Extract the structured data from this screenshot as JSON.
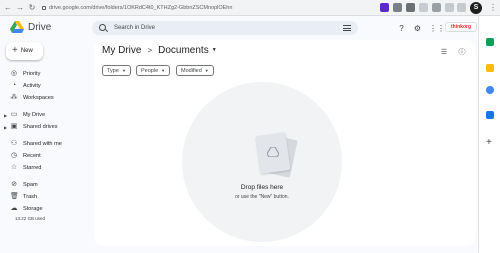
{
  "browser": {
    "url": "drive.google.com/drive/folders/1OKRdC4t0_KTHZg2-GbbnZSCMnoplOEhn",
    "back_glyph": "←",
    "forward_glyph": "→",
    "reload_glyph": "↻",
    "profile_initial": "S"
  },
  "app": {
    "name": "Drive",
    "search_placeholder": "Search in Drive",
    "brand_badge": "thinkorg"
  },
  "sidebar": {
    "new_label": "New",
    "new_glyph": "+",
    "items": [
      {
        "label": "Priority",
        "icon": "check-circle-icon",
        "glyph": "◎"
      },
      {
        "label": "Activity",
        "icon": "activity-icon",
        "glyph": "◔"
      },
      {
        "label": "Workspaces",
        "icon": "workspaces-icon",
        "glyph": "⁂"
      },
      {
        "label": "My Drive",
        "icon": "my-drive-icon",
        "glyph": "▭"
      },
      {
        "label": "Shared drives",
        "icon": "shared-drives-icon",
        "glyph": "▣"
      },
      {
        "label": "Shared with me",
        "icon": "people-icon",
        "glyph": "⚇"
      },
      {
        "label": "Recent",
        "icon": "clock-icon",
        "glyph": "◷"
      },
      {
        "label": "Starred",
        "icon": "star-icon",
        "glyph": "☆"
      },
      {
        "label": "Spam",
        "icon": "spam-icon",
        "glyph": "⊘"
      },
      {
        "label": "Trash",
        "icon": "trash-icon",
        "glyph": "🗑"
      },
      {
        "label": "Storage",
        "icon": "cloud-icon",
        "glyph": "☁"
      }
    ],
    "storage_used": "13.22 GB used"
  },
  "main": {
    "breadcrumb_root": "My Drive",
    "breadcrumb_sep": ">",
    "breadcrumb_current": "Documents",
    "filters": [
      "Type",
      "People",
      "Modified"
    ],
    "drop_title": "Drop files here",
    "drop_sub": "or use the \"New\" button."
  },
  "colors": {
    "drive_yellow": "#fbbc04",
    "drive_green": "#34a853",
    "drive_blue": "#4285f4",
    "search_bg": "#e9eef6"
  }
}
